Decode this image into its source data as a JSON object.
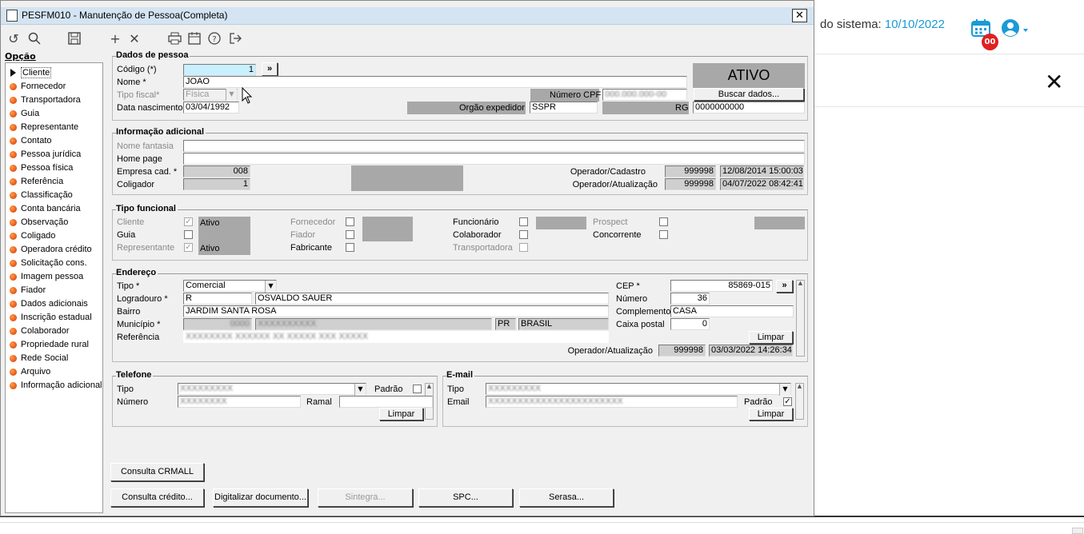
{
  "background_page": {
    "date_label": "do sistema:",
    "date_value": "10/10/2022",
    "badge": "00",
    "icons": {
      "calendar": "calendar-icon",
      "user": "user-circle-icon",
      "close": "close-icon"
    }
  },
  "window": {
    "title": "PESFM010 - Manutenção de Pessoa(Completa)",
    "close": "✕"
  },
  "toolbar": {
    "icons": [
      "undo-icon",
      "search-icon",
      "save-icon",
      "add-icon",
      "delete-icon",
      "print-icon",
      "calendar-icon",
      "help-icon",
      "exit-icon"
    ]
  },
  "options": {
    "title": "Opção",
    "items": [
      "Cliente",
      "Fornecedor",
      "Transportadora",
      "Guia",
      "Representante",
      "Contato",
      "Pessoa jurídica",
      "Pessoa física",
      "Referência",
      "Classificação",
      "Conta bancária",
      "Observação",
      "Coligado",
      "Operadora crédito",
      "Solicitação cons.",
      "Imagem pessoa",
      "Fiador",
      "Dados adicionais",
      "Inscrição estadual",
      "Colaborador",
      "Propriedade rural",
      "Rede Social",
      "Arquivo",
      "Informação adicional"
    ]
  },
  "dados_pessoa": {
    "title": "Dados de pessoa",
    "codigo_label": "Código (*)",
    "codigo": "1",
    "nome_label": "Nome *",
    "nome": "JOAO",
    "tipo_fiscal_label": "Tipo fiscal*",
    "tipo_fiscal": "Física",
    "data_nasc_label": "Data nascimento",
    "data_nasc": "03/04/1992",
    "status": "ATIVO",
    "cpf_label": "Número CPF",
    "cpf": "000.000.000-00",
    "buscar": "Buscar dados...",
    "orgao_label": "Orgão expedidor",
    "orgao": "SSPR",
    "rg_label": "RG",
    "rg": "0000000000",
    "lookup": "»"
  },
  "info_adicional": {
    "title": "Informação adicional",
    "nome_fantasia_label": "Nome fantasia",
    "home_page_label": "Home page",
    "empresa_label": "Empresa cad. *",
    "empresa": "008",
    "coligador_label": "Coligador",
    "coligador": "1",
    "op_cad_label": "Operador/Cadastro",
    "op_cad": "999998",
    "op_cad_date": "12/08/2014 15:00:03",
    "op_atu_label": "Operador/Atualização",
    "op_atu": "999998",
    "op_atu_date": "04/07/2022 08:42:41"
  },
  "tipo_funcional": {
    "title": "Tipo funcional",
    "cliente": "Cliente",
    "ativo": "Ativo",
    "guia": "Guia",
    "representante": "Representante",
    "fornecedor": "Fornecedor",
    "fiador": "Fiador",
    "fabricante": "Fabricante",
    "funcionario": "Funcionário",
    "colaborador": "Colaborador",
    "transportadora": "Transportadora",
    "prospect": "Prospect",
    "concorrente": "Concorrente",
    "check": "✓"
  },
  "endereco": {
    "title": "Endereço",
    "tipo_label": "Tipo *",
    "tipo": "Comercial",
    "logradouro_label": "Logradouro *",
    "logradouro_tipo": "R",
    "logradouro": "OSVALDO SAUER",
    "bairro_label": "Bairro",
    "bairro": "JARDIM SANTA ROSA",
    "municipio_label": "Município *",
    "municipio_cod": "0000",
    "municipio": "XXXXXXXXXX",
    "uf": "PR",
    "pais": "BRASIL",
    "referencia_label": "Referência",
    "referencia": "XXXXXXXX XXXXXX XX XXXXX XXX XXXXX",
    "cep_label": "CEP *",
    "cep": "85869-015",
    "numero_label": "Número",
    "numero": "36",
    "complemento_label": "Complemento",
    "complemento": "CASA",
    "caixa_label": "Caixa postal",
    "caixa": "0",
    "limpar": "Limpar",
    "op_atu_label": "Operador/Atualização",
    "op_atu": "999998",
    "op_atu_date": "03/03/2022 14:26:34"
  },
  "telefone": {
    "title": "Telefone",
    "tipo_label": "Tipo",
    "tipo": "XXXXXXXXX",
    "padrao_label": "Padrão",
    "numero_label": "Número",
    "numero": "XXXXXXXX",
    "ramal_label": "Ramal",
    "limpar": "Limpar"
  },
  "email": {
    "title": "E-mail",
    "tipo_label": "Tipo",
    "tipo": "XXXXXXXXX",
    "email_label": "Email",
    "email": "XXXXXXXXXXXXXXXXXXXXXXX",
    "padrao_label": "Padrão",
    "limpar": "Limpar",
    "check": "✓"
  },
  "buttons": {
    "crmall": "Consulta CRMALL",
    "credito": "Consulta crédito...",
    "digitalizar": "Digitalizar documento...",
    "sintegra": "Sintegra...",
    "spc": "SPC...",
    "serasa": "Serasa..."
  }
}
